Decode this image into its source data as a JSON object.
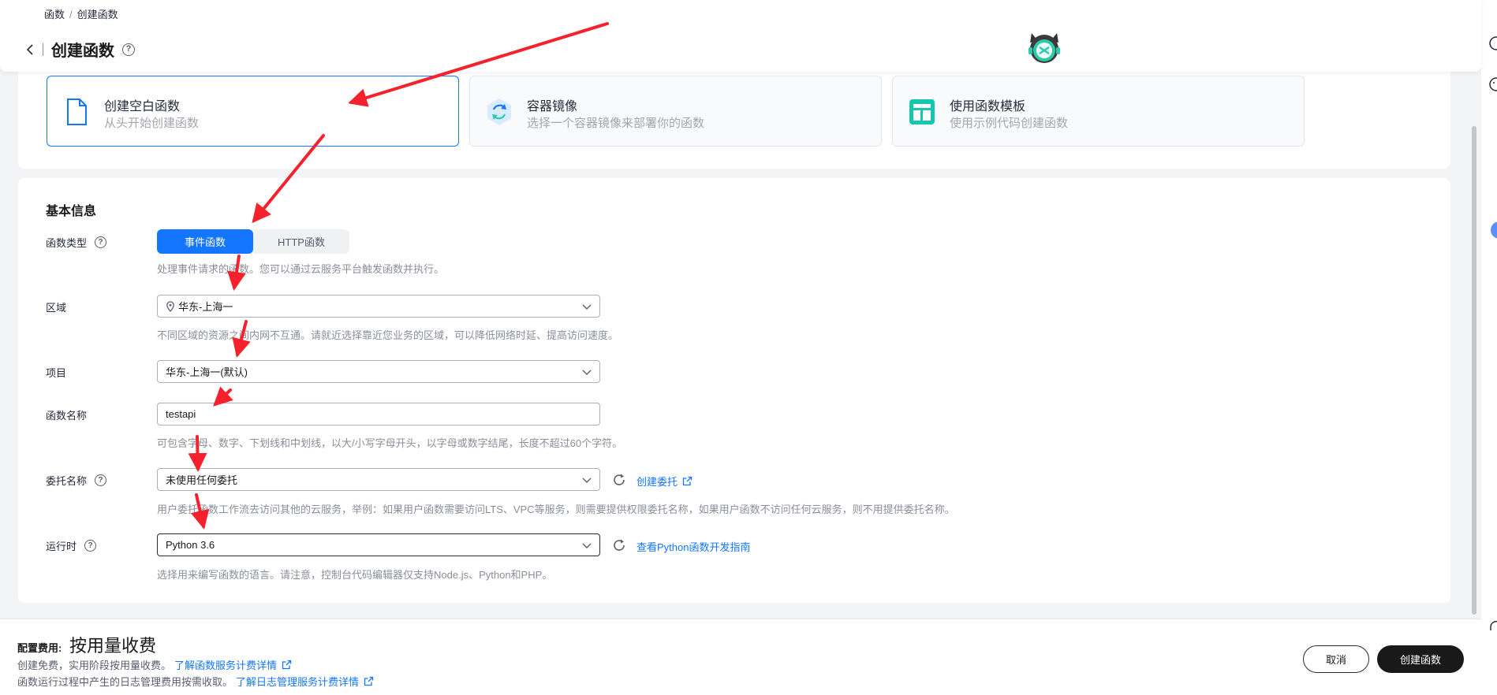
{
  "breadcrumb": {
    "parent": "函数",
    "separator": "/",
    "current": "创建函数"
  },
  "header": {
    "title": "创建函数",
    "help": "?"
  },
  "cards": [
    {
      "title": "创建空白函数",
      "desc": "从头开始创建函数",
      "icon": "file-icon",
      "selected": true
    },
    {
      "title": "容器镜像",
      "desc": "选择一个容器镜像来部署你的函数",
      "icon": "container-icon",
      "selected": false
    },
    {
      "title": "使用函数模板",
      "desc": "使用示例代码创建函数",
      "icon": "template-icon",
      "selected": false
    }
  ],
  "basic": {
    "title": "基本信息",
    "func_type": {
      "label": "函数类型",
      "options": [
        "事件函数",
        "HTTP函数"
      ],
      "selected": "事件函数",
      "hint": "处理事件请求的函数。您可以通过云服务平台触发函数并执行。"
    },
    "region": {
      "label": "区域",
      "value": "华东-上海一",
      "hint": "不同区域的资源之间内网不互通。请就近选择靠近您业务的区域，可以降低网络时延、提高访问速度。"
    },
    "project": {
      "label": "项目",
      "value": "华东-上海一(默认)"
    },
    "name": {
      "label": "函数名称",
      "value": "testapi",
      "hint": "可包含字母、数字、下划线和中划线，以大/小写字母开头，以字母或数字结尾，长度不超过60个字符。"
    },
    "agency": {
      "label": "委托名称",
      "value": "未使用任何委托",
      "link": "创建委托",
      "hint": "用户委托函数工作流去访问其他的云服务，举例：如果用户函数需要访问LTS、VPC等服务，则需要提供权限委托名称，如果用户函数不访问任何云服务，则不用提供委托名称。"
    },
    "runtime": {
      "label": "运行时",
      "value": "Python 3.6",
      "link": "查看Python函数开发指南",
      "hint": "选择用来编写函数的语言。请注意，控制台代码编辑器仅支持Node.js、Python和PHP。"
    }
  },
  "footer": {
    "fee_label": "配置费用:",
    "fee_value": "按用量收费",
    "line1": "创建免费，实用阶段按用量收费。",
    "line1_link": "了解函数服务计费详情",
    "line2": "函数运行过程中产生的日志管理费用按需收取。",
    "line2_link": "了解日志管理服务计费详情",
    "cancel": "取消",
    "create": "创建函数"
  },
  "colors": {
    "accent": "#1476ff",
    "annotation": "#f5222d",
    "primary_button": "#191919"
  }
}
